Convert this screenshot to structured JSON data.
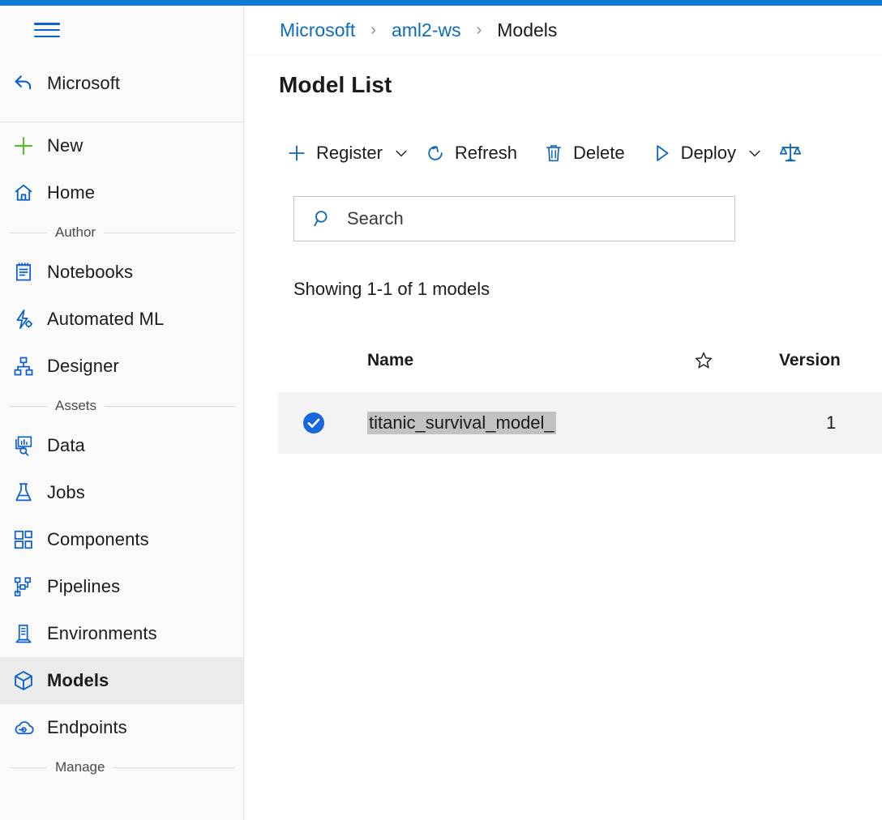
{
  "theme": {
    "accent_bar": "#0c7cd5",
    "link_blue": "#0f6cbd",
    "icon_blue": "#0c5fce",
    "new_green": "#5fb832",
    "selected_row_bg": "#f3f3f3",
    "selected_nav_bg": "#ebebeb",
    "selection_highlight": "#c2c2c2"
  },
  "sidebar": {
    "menu_icon": "hamburger-icon",
    "account": {
      "label": "Microsoft",
      "icon": "back-arrow-icon"
    },
    "primary": [
      {
        "label": "New",
        "icon": "plus-icon"
      },
      {
        "label": "Home",
        "icon": "home-icon"
      }
    ],
    "sections": [
      {
        "title": "Author",
        "items": [
          {
            "label": "Notebooks",
            "icon": "notebook-icon"
          },
          {
            "label": "Automated ML",
            "icon": "automated-ml-icon"
          },
          {
            "label": "Designer",
            "icon": "designer-icon"
          }
        ]
      },
      {
        "title": "Assets",
        "items": [
          {
            "label": "Data",
            "icon": "data-icon"
          },
          {
            "label": "Jobs",
            "icon": "jobs-flask-icon"
          },
          {
            "label": "Components",
            "icon": "components-icon"
          },
          {
            "label": "Pipelines",
            "icon": "pipelines-icon"
          },
          {
            "label": "Environments",
            "icon": "environments-icon"
          },
          {
            "label": "Models",
            "icon": "models-cube-icon",
            "selected": true
          },
          {
            "label": "Endpoints",
            "icon": "endpoints-cloud-icon"
          }
        ]
      },
      {
        "title": "Manage",
        "items": []
      }
    ]
  },
  "breadcrumb": {
    "items": [
      {
        "label": "Microsoft",
        "is_link": true
      },
      {
        "label": "aml2-ws",
        "is_link": true
      },
      {
        "label": "Models",
        "is_link": false
      }
    ],
    "separator": "›"
  },
  "main": {
    "title": "Model List",
    "toolbar": [
      {
        "label": "Register",
        "icon": "plus-icon",
        "has_dropdown": true
      },
      {
        "label": "Refresh",
        "icon": "refresh-icon",
        "has_dropdown": false
      },
      {
        "label": "Delete",
        "icon": "trash-icon",
        "has_dropdown": false
      },
      {
        "label": "Deploy",
        "icon": "play-triangle-icon",
        "has_dropdown": true
      }
    ],
    "toolbar_icon_only": {
      "icon": "balance-scales-icon",
      "label": ""
    },
    "search": {
      "placeholder": "Search",
      "value": "",
      "icon": "search-icon"
    },
    "showing_text": "Showing 1-1 of 1 models",
    "table": {
      "columns": [
        {
          "key": "name",
          "label": "Name"
        },
        {
          "key": "favorite",
          "label": "",
          "icon": "star-outline-icon"
        },
        {
          "key": "version",
          "label": "Version"
        }
      ],
      "rows": [
        {
          "selected": true,
          "name": "titanic_survival_model_",
          "name_highlighted": true,
          "version": "1"
        }
      ]
    }
  }
}
